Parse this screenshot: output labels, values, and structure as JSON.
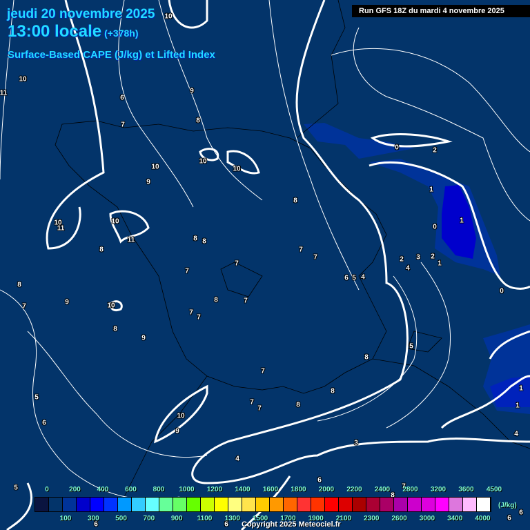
{
  "header": {
    "date": "jeudi 20 novembre 2025",
    "time": "13:00 locale",
    "lead": "(+378h)",
    "parameter": "Surface-Based CAPE (J/kg) et Lifted Index",
    "run": "Run GFS 18Z du mardi 4 novembre 2025"
  },
  "colors": {
    "background": "#03346a",
    "contour": "#ffffff",
    "cape_low": "#003399",
    "cape_mid": "#0000cc"
  },
  "contour_labels": [
    "10",
    "11",
    "10",
    "6",
    "9",
    "8",
    "7",
    "10",
    "10",
    "10",
    "9",
    "8",
    "10",
    "11",
    "10",
    "11",
    "8",
    "8",
    "8",
    "7",
    "7",
    "7",
    "7",
    "8",
    "9",
    "7",
    "10",
    "8",
    "7",
    "7",
    "7",
    "8",
    "9",
    "6",
    "5",
    "4",
    "0",
    "2",
    "1",
    "0",
    "1",
    "2",
    "3",
    "2",
    "4",
    "1",
    "0",
    "5",
    "8",
    "7",
    "8",
    "5",
    "7",
    "7",
    "8",
    "10",
    "9",
    "6",
    "1",
    "1",
    "4",
    "3",
    "4",
    "6",
    "5",
    "7",
    "8",
    "6",
    "6",
    "6",
    "6"
  ],
  "colorbar": {
    "unit": "(J/kg)",
    "colors": [
      "#0a1440",
      "#03346a",
      "#003399",
      "#0000cc",
      "#0000ff",
      "#0033ff",
      "#0099ff",
      "#33ccff",
      "#66ffff",
      "#66ff99",
      "#66ff66",
      "#66ff00",
      "#ccff00",
      "#ffff00",
      "#ffff80",
      "#ffe44c",
      "#ffcc00",
      "#ff9900",
      "#ff6600",
      "#ff3333",
      "#ff3300",
      "#ff0000",
      "#dd0000",
      "#aa0000",
      "#aa0033",
      "#aa0066",
      "#aa00aa",
      "#cc00cc",
      "#dd00dd",
      "#ff00ff",
      "#dd77dd",
      "#ffbbff",
      "#ffffff"
    ],
    "top_labels": [
      "0",
      "200",
      "400",
      "600",
      "800",
      "1000",
      "1200",
      "1400",
      "1600",
      "1800",
      "2000",
      "2200",
      "2400",
      "2800",
      "3200",
      "3600",
      "4500"
    ],
    "bottom_labels": [
      "100",
      "300",
      "500",
      "700",
      "900",
      "1100",
      "1300",
      "1500",
      "1700",
      "1900",
      "2100",
      "2300",
      "2600",
      "3000",
      "3400",
      "4000"
    ]
  },
  "copyright": "Copyright 2025 Meteociel.fr"
}
